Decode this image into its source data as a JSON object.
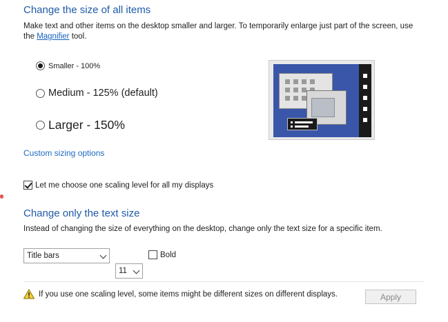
{
  "scale_section": {
    "title": "Change the size of all items",
    "desc_before_link": "Make text and other items on the desktop smaller and larger. To temporarily enlarge just part of the screen, use the ",
    "magnifier_link": "Magnifier",
    "desc_after_link": " tool.",
    "options": [
      {
        "label": "Smaller - 100%",
        "selected": true
      },
      {
        "label": "Medium - 125% (default)",
        "selected": false
      },
      {
        "label": "Larger - 150%",
        "selected": false
      }
    ],
    "custom_sizing_link": "Custom sizing options",
    "one_scaling_checkbox": {
      "label": "Let me choose one scaling level for all my displays",
      "checked": true
    }
  },
  "text_section": {
    "title": "Change only the text size",
    "desc": "Instead of changing the size of everything on the desktop, change only the text size for a specific item.",
    "item_select": "Title bars",
    "size_select": "11",
    "bold_checkbox": {
      "label": "Bold",
      "checked": false
    }
  },
  "footer": {
    "warning_text": "If you use one scaling level, some items might be different sizes on different displays.",
    "apply_label": "Apply"
  },
  "colors": {
    "heading": "#1e5aa8",
    "link": "#1560bd",
    "desktop_preview": "#3a56a9"
  },
  "icons": {
    "warning": "warning-triangle-icon",
    "chevron": "chevron-down-icon"
  }
}
